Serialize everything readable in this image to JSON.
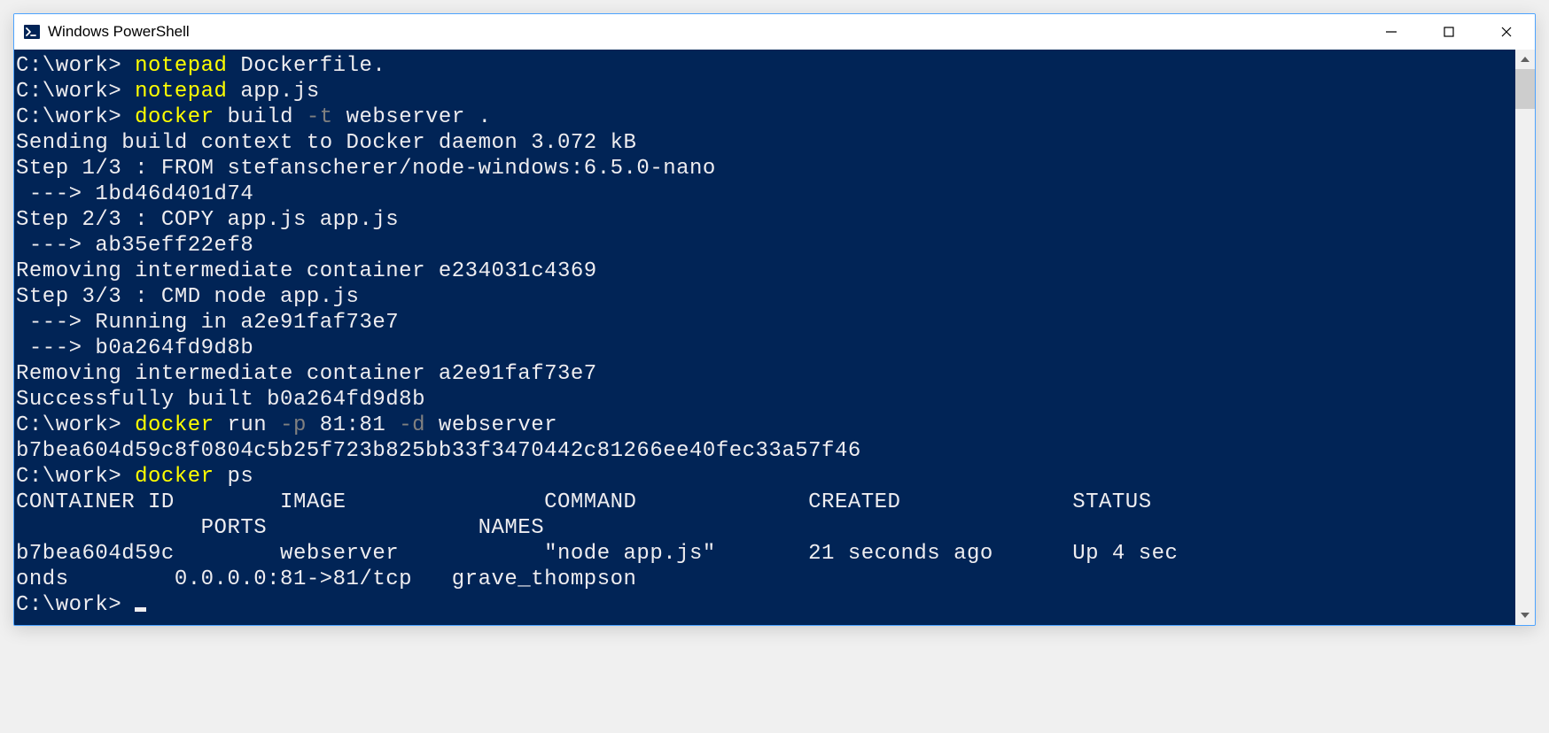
{
  "window": {
    "title": "Windows PowerShell"
  },
  "colors": {
    "terminal_bg": "#012456",
    "terminal_fg": "#eeedf0",
    "yellow": "#ffff00",
    "darkgray": "#808080"
  },
  "lines": [
    {
      "segments": [
        {
          "t": "C:\\work> ",
          "c": "white"
        },
        {
          "t": "notepad ",
          "c": "yellow"
        },
        {
          "t": "Dockerfile.",
          "c": "white"
        }
      ]
    },
    {
      "segments": [
        {
          "t": "C:\\work> ",
          "c": "white"
        },
        {
          "t": "notepad ",
          "c": "yellow"
        },
        {
          "t": "app.js",
          "c": "white"
        }
      ]
    },
    {
      "segments": [
        {
          "t": "C:\\work> ",
          "c": "white"
        },
        {
          "t": "docker ",
          "c": "yellow"
        },
        {
          "t": "build ",
          "c": "white"
        },
        {
          "t": "-t ",
          "c": "darkgray"
        },
        {
          "t": "webserver .",
          "c": "white"
        }
      ]
    },
    {
      "segments": [
        {
          "t": "Sending build context to Docker daemon 3.072 kB",
          "c": "white"
        }
      ]
    },
    {
      "segments": [
        {
          "t": "Step 1/3 : FROM stefanscherer/node-windows:6.5.0-nano",
          "c": "white"
        }
      ]
    },
    {
      "segments": [
        {
          "t": " ---> 1bd46d401d74",
          "c": "white"
        }
      ]
    },
    {
      "segments": [
        {
          "t": "Step 2/3 : COPY app.js app.js",
          "c": "white"
        }
      ]
    },
    {
      "segments": [
        {
          "t": " ---> ab35eff22ef8",
          "c": "white"
        }
      ]
    },
    {
      "segments": [
        {
          "t": "Removing intermediate container e234031c4369",
          "c": "white"
        }
      ]
    },
    {
      "segments": [
        {
          "t": "Step 3/3 : CMD node app.js",
          "c": "white"
        }
      ]
    },
    {
      "segments": [
        {
          "t": " ---> Running in a2e91faf73e7",
          "c": "white"
        }
      ]
    },
    {
      "segments": [
        {
          "t": " ---> b0a264fd9d8b",
          "c": "white"
        }
      ]
    },
    {
      "segments": [
        {
          "t": "Removing intermediate container a2e91faf73e7",
          "c": "white"
        }
      ]
    },
    {
      "segments": [
        {
          "t": "Successfully built b0a264fd9d8b",
          "c": "white"
        }
      ]
    },
    {
      "segments": [
        {
          "t": "C:\\work> ",
          "c": "white"
        },
        {
          "t": "docker ",
          "c": "yellow"
        },
        {
          "t": "run ",
          "c": "white"
        },
        {
          "t": "-p ",
          "c": "darkgray"
        },
        {
          "t": "81:81 ",
          "c": "white"
        },
        {
          "t": "-d ",
          "c": "darkgray"
        },
        {
          "t": "webserver",
          "c": "white"
        }
      ]
    },
    {
      "segments": [
        {
          "t": "b7bea604d59c8f0804c5b25f723b825bb33f3470442c81266ee40fec33a57f46",
          "c": "white"
        }
      ]
    },
    {
      "segments": [
        {
          "t": "C:\\work> ",
          "c": "white"
        },
        {
          "t": "docker ",
          "c": "yellow"
        },
        {
          "t": "ps",
          "c": "white"
        }
      ]
    },
    {
      "segments": [
        {
          "t": "CONTAINER ID        IMAGE               COMMAND             CREATED             STATUS",
          "c": "white"
        }
      ]
    },
    {
      "segments": [
        {
          "t": "              PORTS                NAMES",
          "c": "white"
        }
      ]
    },
    {
      "segments": [
        {
          "t": "b7bea604d59c        webserver           \"node app.js\"       21 seconds ago      Up 4 sec",
          "c": "white"
        }
      ]
    },
    {
      "segments": [
        {
          "t": "onds        0.0.0.0:81->81/tcp   grave_thompson",
          "c": "white"
        }
      ]
    },
    {
      "segments": [
        {
          "t": "C:\\work> ",
          "c": "white"
        }
      ],
      "cursor": true
    }
  ]
}
